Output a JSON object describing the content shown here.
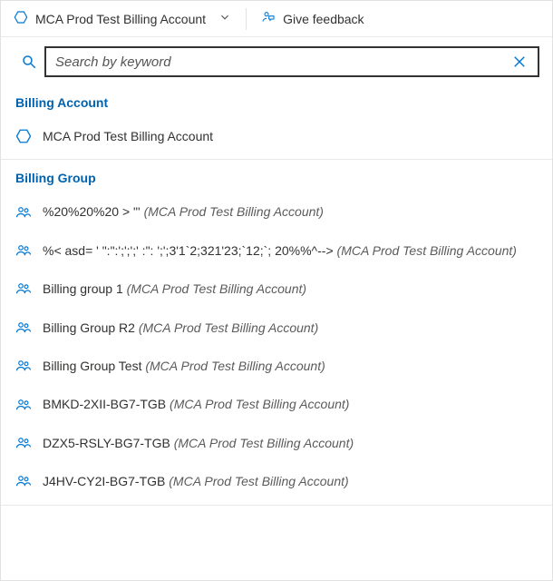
{
  "topbar": {
    "scope_label": "MCA Prod Test Billing Account",
    "feedback_label": "Give feedback"
  },
  "search": {
    "placeholder": "Search by keyword",
    "value": ""
  },
  "sections": [
    {
      "heading": "Billing Account",
      "icon": "hexagon",
      "items": [
        {
          "name": "MCA Prod Test Billing Account",
          "parent": ""
        }
      ]
    },
    {
      "heading": "Billing Group",
      "icon": "group",
      "items": [
        {
          "name": "%20%20%20 > \"'",
          "parent": "(MCA Prod Test Billing Account)"
        },
        {
          "name": "%< asd= ' \":\":';';';' :\": ';';3'1`2;321'23;`12;`; 20%%^-->",
          "parent": "(MCA Prod Test Billing Account)"
        },
        {
          "name": "Billing group 1",
          "parent": "(MCA Prod Test Billing Account)"
        },
        {
          "name": "Billing Group R2",
          "parent": "(MCA Prod Test Billing Account)"
        },
        {
          "name": "Billing Group Test",
          "parent": "(MCA Prod Test Billing Account)"
        },
        {
          "name": "BMKD-2XII-BG7-TGB",
          "parent": "(MCA Prod Test Billing Account)"
        },
        {
          "name": "DZX5-RSLY-BG7-TGB",
          "parent": "(MCA Prod Test Billing Account)"
        },
        {
          "name": "J4HV-CY2I-BG7-TGB",
          "parent": "(MCA Prod Test Billing Account)"
        }
      ]
    }
  ]
}
